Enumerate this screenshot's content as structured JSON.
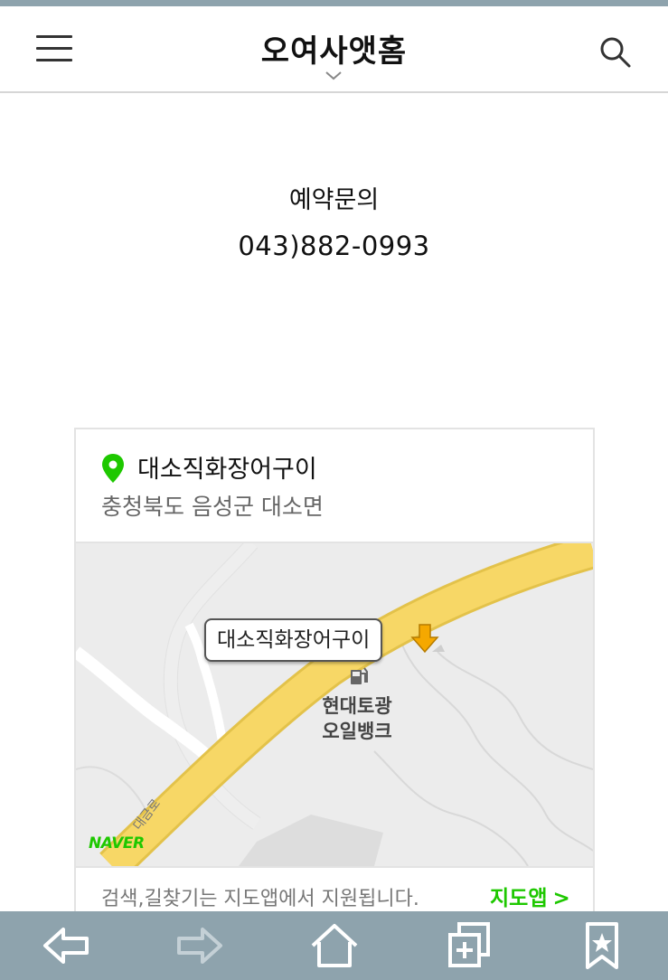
{
  "header": {
    "title": "오여사앳홈"
  },
  "contact": {
    "label": "예약문의",
    "phone": "043)882-0993"
  },
  "map_card": {
    "place_name": "대소직화장어구이",
    "address": "충청북도 음성군 대소면",
    "map": {
      "marker_label": "대소직화장어구이",
      "poi_name_line1": "현대토광",
      "poi_name_line2": "오일뱅크",
      "road_label": "대금로",
      "logo": "NAVER"
    },
    "footer_note": "검색,길찾기는 지도앱에서 지원됩니다.",
    "map_app_link": "지도앱",
    "map_app_link_chevron": ">"
  },
  "colors": {
    "accent_green": "#1ec800",
    "bar_gray_blue": "#8ea3ad",
    "road_yellow": "#f7d766"
  },
  "bottom_nav": {
    "icons": [
      "back-arrow-icon",
      "forward-arrow-icon",
      "home-icon",
      "tabs-icon",
      "bookmark-icon"
    ]
  }
}
